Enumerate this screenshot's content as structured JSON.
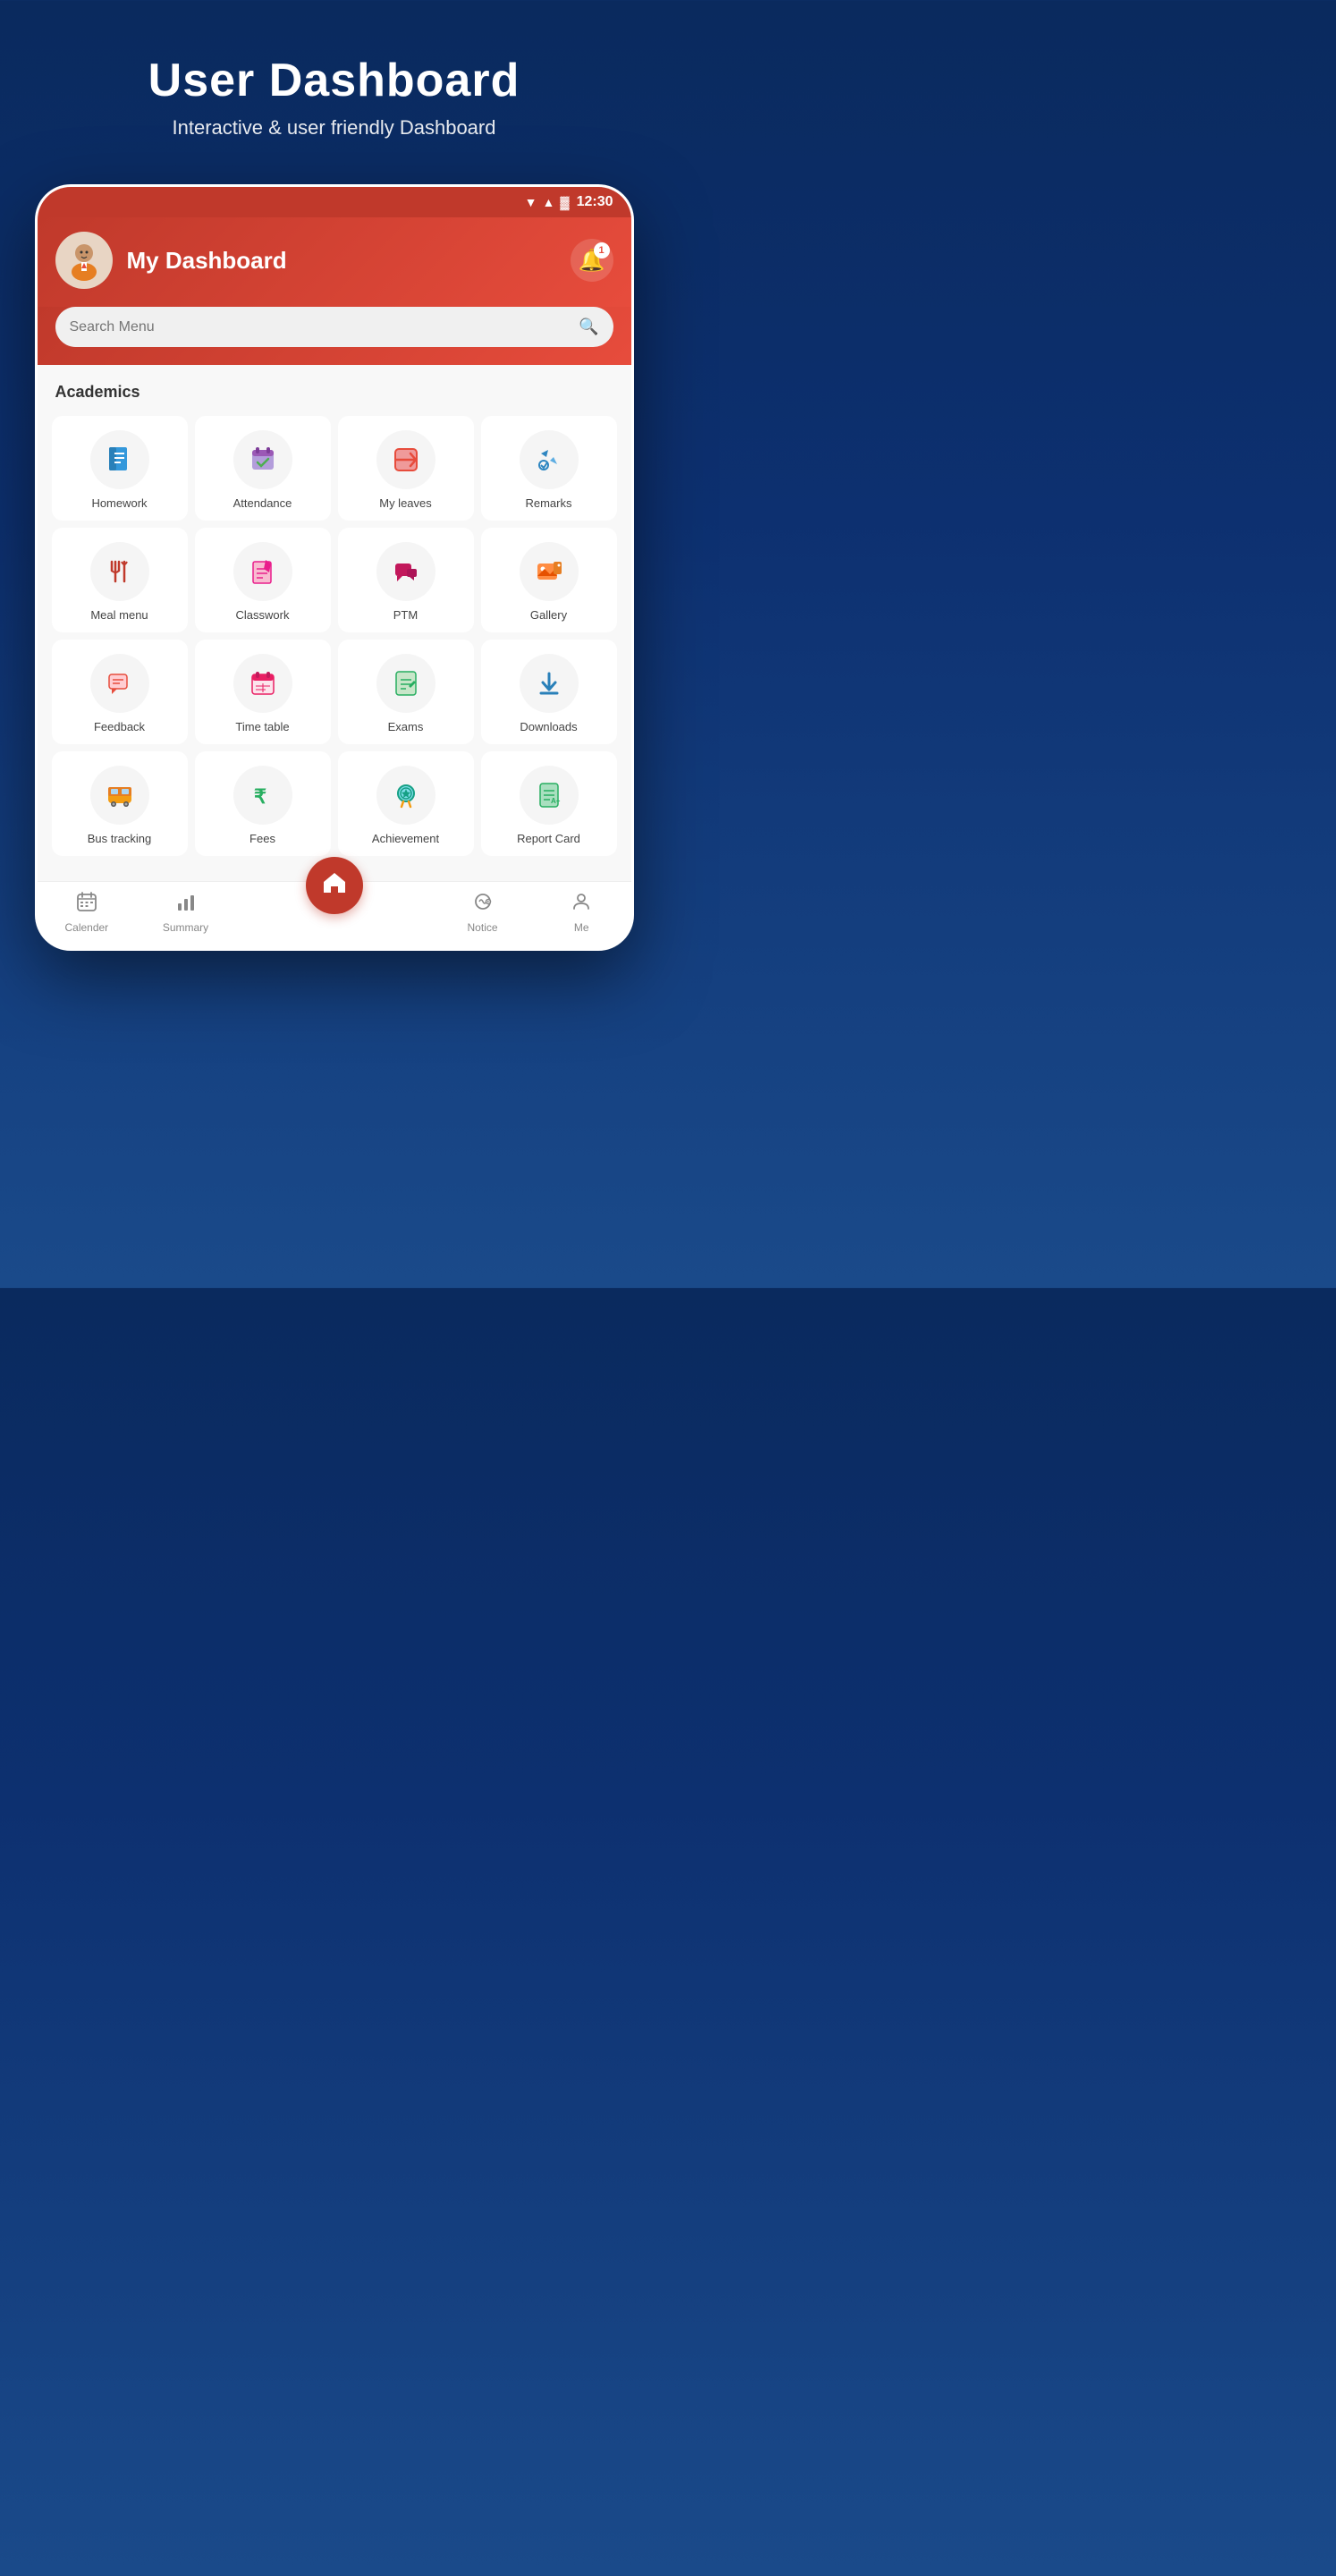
{
  "page": {
    "title": "User Dashboard",
    "subtitle": "Interactive & user friendly Dashboard"
  },
  "status_bar": {
    "time": "12:30",
    "battery_icon": "🔋",
    "signal_icon": "▲",
    "wifi_icon": "▼"
  },
  "header": {
    "title": "My Dashboard",
    "notification_count": "1",
    "search_placeholder": "Search Menu"
  },
  "sections": [
    {
      "title": "Academics",
      "items": [
        {
          "label": "Homework",
          "icon": "📄",
          "color": "#3498db"
        },
        {
          "label": "Attendance",
          "icon": "✅",
          "color": "#9b59b6"
        },
        {
          "label": "My leaves",
          "icon": "🔄",
          "color": "#e74c3c"
        },
        {
          "label": "Remarks",
          "icon": "👍",
          "color": "#2e86c1"
        },
        {
          "label": "Meal menu",
          "icon": "🍴",
          "color": "#c0392b"
        },
        {
          "label": "Classwork",
          "icon": "📝",
          "color": "#e91e8c"
        },
        {
          "label": "PTM",
          "icon": "💬",
          "color": "#ad1457"
        },
        {
          "label": "Gallery",
          "icon": "🎬",
          "color": "#e67e22"
        },
        {
          "label": "Feedback",
          "icon": "💬",
          "color": "#e74c3c"
        },
        {
          "label": "Time table",
          "icon": "📅",
          "color": "#e91e63"
        },
        {
          "label": "Exams",
          "icon": "📋",
          "color": "#27ae60"
        },
        {
          "label": "Downloads",
          "icon": "⬇️",
          "color": "#2980b9"
        },
        {
          "label": "Bus tracking",
          "icon": "🚌",
          "color": "#f39c12"
        },
        {
          "label": "Fees",
          "icon": "₹",
          "color": "#27ae60"
        },
        {
          "label": "Achievement",
          "icon": "🏅",
          "color": "#16a085"
        },
        {
          "label": "Report Card",
          "icon": "📄",
          "color": "#27ae60"
        }
      ]
    }
  ],
  "bottom_nav": {
    "items": [
      {
        "label": "Calender",
        "icon": "📅"
      },
      {
        "label": "Summary",
        "icon": "📊"
      },
      {
        "label": "",
        "icon": "🏠",
        "is_home": true
      },
      {
        "label": "Notice",
        "icon": "🔊"
      },
      {
        "label": "Me",
        "icon": "👤"
      }
    ]
  }
}
